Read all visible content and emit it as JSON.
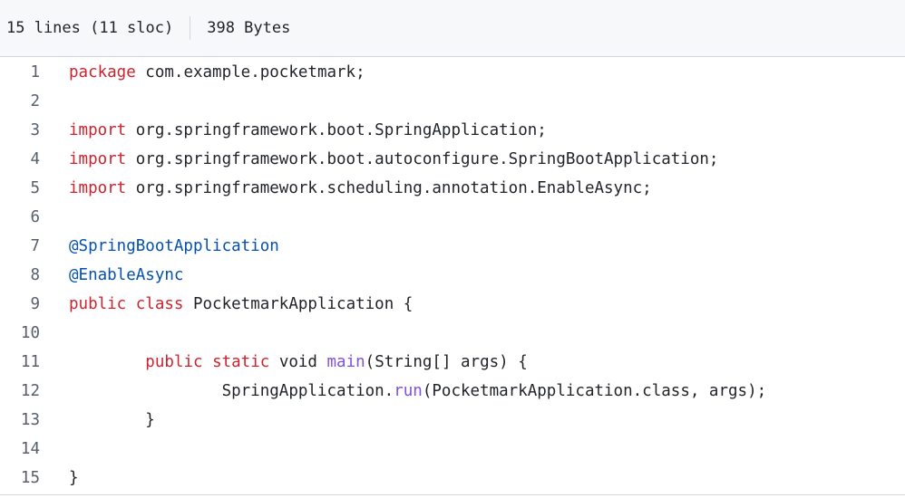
{
  "header": {
    "lines_info": "15 lines (11 sloc)",
    "size_info": "398 Bytes"
  },
  "colors": {
    "keyword": "#cf222e",
    "annotation": "#0550ae",
    "function": "#8250df",
    "plain": "#1f2328",
    "line_number": "#57606a"
  },
  "code": {
    "lines": [
      {
        "num": "1",
        "tokens": [
          {
            "t": "kw",
            "v": "package"
          },
          {
            "t": "plain",
            "v": " com.example.pocketmark;"
          }
        ]
      },
      {
        "num": "2",
        "tokens": []
      },
      {
        "num": "3",
        "tokens": [
          {
            "t": "kw",
            "v": "import"
          },
          {
            "t": "plain",
            "v": " org.springframework.boot.SpringApplication;"
          }
        ]
      },
      {
        "num": "4",
        "tokens": [
          {
            "t": "kw",
            "v": "import"
          },
          {
            "t": "plain",
            "v": " org.springframework.boot.autoconfigure.SpringBootApplication;"
          }
        ]
      },
      {
        "num": "5",
        "tokens": [
          {
            "t": "kw",
            "v": "import"
          },
          {
            "t": "plain",
            "v": " org.springframework.scheduling.annotation.EnableAsync;"
          }
        ]
      },
      {
        "num": "6",
        "tokens": []
      },
      {
        "num": "7",
        "tokens": [
          {
            "t": "ann",
            "v": "@SpringBootApplication"
          }
        ]
      },
      {
        "num": "8",
        "tokens": [
          {
            "t": "ann",
            "v": "@EnableAsync"
          }
        ]
      },
      {
        "num": "9",
        "tokens": [
          {
            "t": "kw",
            "v": "public"
          },
          {
            "t": "plain",
            "v": " "
          },
          {
            "t": "kw",
            "v": "class"
          },
          {
            "t": "plain",
            "v": " PocketmarkApplication {"
          }
        ]
      },
      {
        "num": "10",
        "tokens": []
      },
      {
        "num": "11",
        "tokens": [
          {
            "t": "plain",
            "v": "        "
          },
          {
            "t": "kw",
            "v": "public"
          },
          {
            "t": "plain",
            "v": " "
          },
          {
            "t": "kw",
            "v": "static"
          },
          {
            "t": "plain",
            "v": " void "
          },
          {
            "t": "fn",
            "v": "main"
          },
          {
            "t": "plain",
            "v": "(String[] args) {"
          }
        ]
      },
      {
        "num": "12",
        "tokens": [
          {
            "t": "plain",
            "v": "                SpringApplication."
          },
          {
            "t": "fn",
            "v": "run"
          },
          {
            "t": "plain",
            "v": "(PocketmarkApplication.class, args);"
          }
        ]
      },
      {
        "num": "13",
        "tokens": [
          {
            "t": "plain",
            "v": "        }"
          }
        ]
      },
      {
        "num": "14",
        "tokens": []
      },
      {
        "num": "15",
        "tokens": [
          {
            "t": "plain",
            "v": "}"
          }
        ]
      }
    ]
  }
}
